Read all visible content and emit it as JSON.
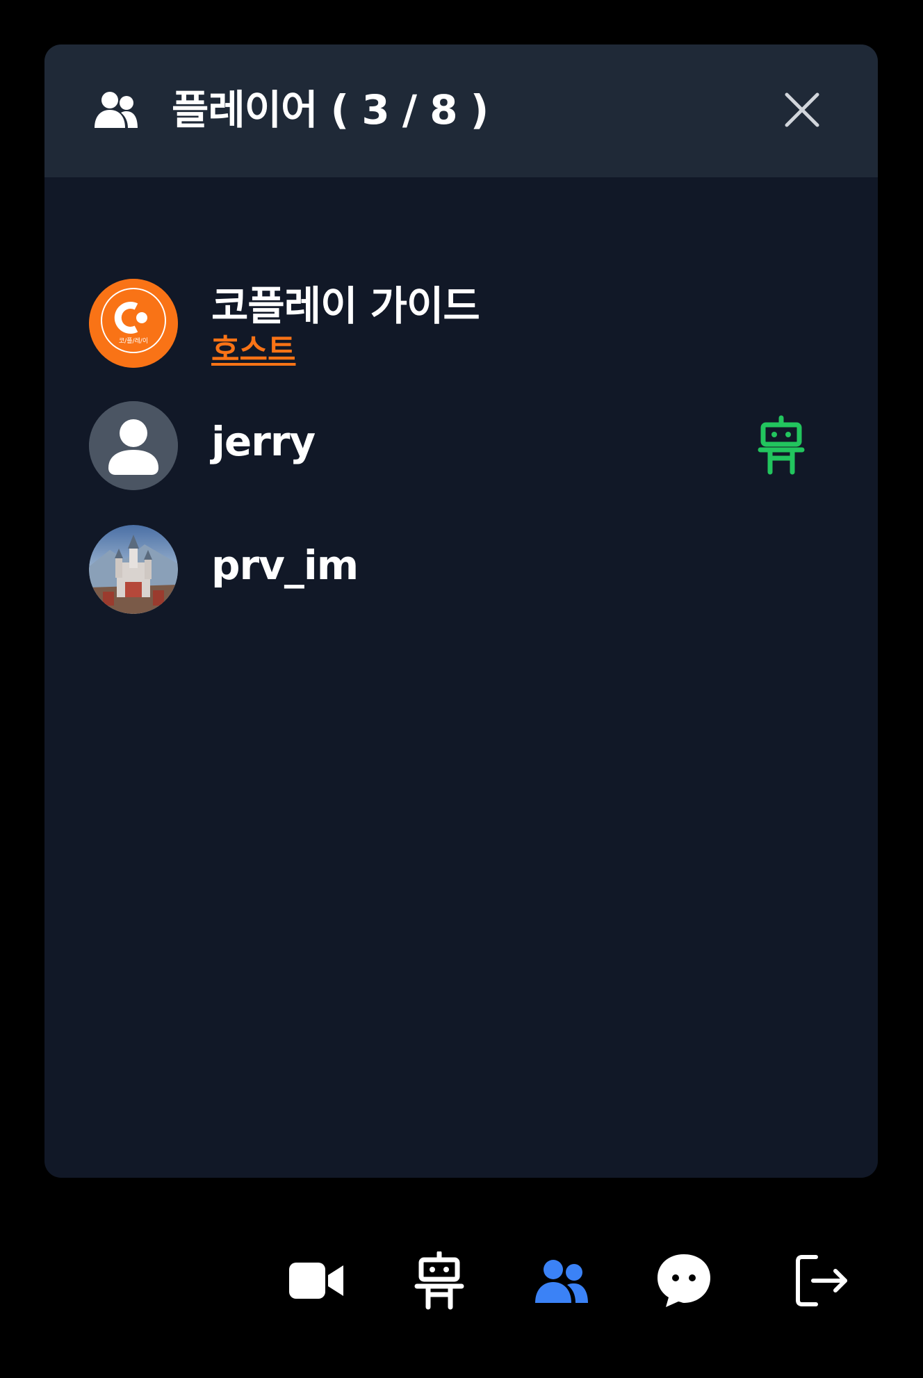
{
  "header": {
    "title": "플레이어 ( 3 / 8 )",
    "icon": "users-icon",
    "close_icon": "close-icon"
  },
  "players": [
    {
      "name": "코플레이 가이드",
      "role": "호스트",
      "avatar": "coplay-logo-avatar",
      "avatar_text": "코/플/레/이"
    },
    {
      "name": "jerry",
      "avatar": "default-user-avatar",
      "status_icon": "robot-icon"
    },
    {
      "name": "prv_im",
      "avatar": "castle-photo-avatar"
    }
  ],
  "toolbar": {
    "items": [
      {
        "name": "video-icon",
        "active": false
      },
      {
        "name": "robot-icon",
        "active": false
      },
      {
        "name": "users-icon",
        "active": true
      },
      {
        "name": "chat-icon",
        "active": false
      },
      {
        "name": "exit-icon",
        "active": false
      }
    ]
  },
  "colors": {
    "background": "#000000",
    "panel": "#111827",
    "header": "#1f2937",
    "accent_orange": "#f97316",
    "accent_green": "#22c55e",
    "accent_blue": "#3b82f6",
    "default_avatar": "#4b5563"
  }
}
